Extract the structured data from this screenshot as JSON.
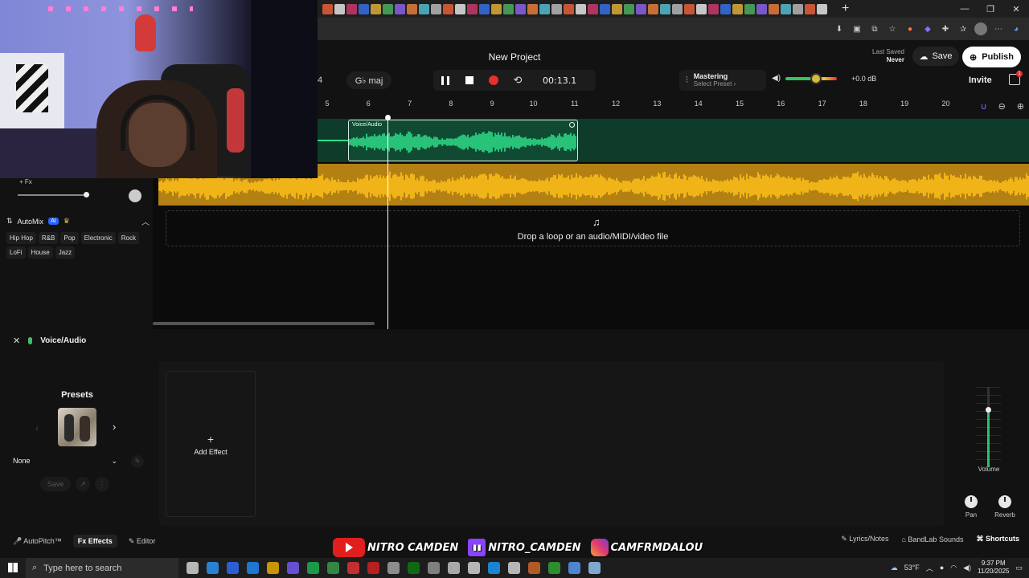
{
  "project": {
    "title": "New Project",
    "last_saved_label": "Last Saved",
    "last_saved_value": "Never",
    "save_label": "Save",
    "publish_label": "Publish",
    "invite_label": "Invite",
    "cart_badge": "1"
  },
  "transport": {
    "key_partial": "4",
    "scale_label": "G♭ maj",
    "time": "00:13.1"
  },
  "mastering": {
    "title": "Mastering",
    "subtitle": "Select Preset ›"
  },
  "master_volume": {
    "db_label": "+0.0 dB",
    "level": 0.6
  },
  "ruler": {
    "ticks": [
      "5",
      "6",
      "7",
      "8",
      "9",
      "10",
      "11",
      "12",
      "13",
      "14",
      "15",
      "16",
      "17",
      "18",
      "19",
      "20"
    ]
  },
  "track_panel": {
    "fx_label": "+ Fx",
    "automix_label": "AutoMix",
    "ai_badge": "AI",
    "genres": [
      "Hip Hop",
      "R&B",
      "Pop",
      "Electronic",
      "Rock",
      "LoFi",
      "House",
      "Jazz"
    ]
  },
  "tracks": {
    "clip_label": "Voice/Audio",
    "drop_text": "Drop a loop or an audio/MIDI/video file",
    "colors": {
      "voice_track": "#0e3b2a",
      "voice_clip": "#104a33",
      "voice_wave": "#2fe08a",
      "beat_track": "#b38014",
      "beat_wave": "#ffc21a"
    }
  },
  "bottom_panel": {
    "track_name": "Voice/Audio",
    "presets_title": "Presets",
    "preset_selected": "None",
    "preset_save": "Save",
    "add_effect": "Add Effect",
    "volume_label": "Volume",
    "pan_label": "Pan",
    "reverb_label": "Reverb",
    "volume_level": 0.72
  },
  "bottom_bar": {
    "autopitch": "AutoPitch™",
    "effects": "Effects",
    "editor": "Editor",
    "lyrics": "Lyrics/Notes",
    "sounds": "BandLab Sounds",
    "shortcuts": "Shortcuts"
  },
  "social": {
    "youtube": "NITRO CAMDEN",
    "twitch": "NITRO_CAMDEN",
    "instagram": "CAMFRMDALOU"
  },
  "taskbar": {
    "search_placeholder": "Type here to search",
    "weather": "53°F",
    "time": "9:37 PM",
    "date": "11/20/2025"
  }
}
